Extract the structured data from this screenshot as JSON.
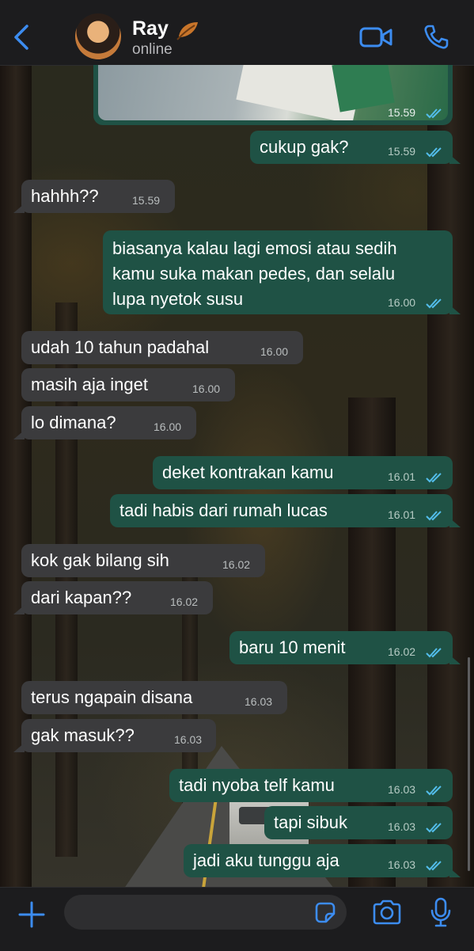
{
  "header": {
    "contact_name": "Ray",
    "status": "online"
  },
  "image_message": {
    "time": "15.59"
  },
  "messages": [
    {
      "dir": "out",
      "text": "cukup gak?",
      "time": "15.59"
    },
    {
      "dir": "in",
      "text": "hahhh??",
      "time": "15.59"
    },
    {
      "dir": "out",
      "lines": [
        "biasanya kalau lagi emosi atau sedih",
        "kamu suka makan pedes, dan selalu",
        "lupa nyetok susu"
      ],
      "time": "16.00"
    },
    {
      "dir": "in",
      "text": "udah 10 tahun padahal",
      "time": "16.00"
    },
    {
      "dir": "in",
      "text": "masih aja inget",
      "time": "16.00"
    },
    {
      "dir": "in",
      "text": "lo dimana?",
      "time": "16.00"
    },
    {
      "dir": "out",
      "text": "deket kontrakan kamu",
      "time": "16.01"
    },
    {
      "dir": "out",
      "text": "tadi habis dari rumah lucas",
      "time": "16.01"
    },
    {
      "dir": "in",
      "text": "kok gak bilang sih",
      "time": "16.02"
    },
    {
      "dir": "in",
      "text": "dari kapan??",
      "time": "16.02"
    },
    {
      "dir": "out",
      "text": "baru 10 menit",
      "time": "16.02"
    },
    {
      "dir": "in",
      "text": "terus ngapain disana",
      "time": "16.03"
    },
    {
      "dir": "in",
      "text": "gak masuk??",
      "time": "16.03"
    },
    {
      "dir": "out",
      "text": "tadi nyoba telf kamu",
      "time": "16.03"
    },
    {
      "dir": "out",
      "text": "tapi sibuk",
      "time": "16.03"
    },
    {
      "dir": "out",
      "text": "jadi aku tunggu aja",
      "time": "16.03"
    }
  ],
  "composer": {
    "placeholder": ""
  },
  "colors": {
    "accent": "#3c8cf0",
    "outgoing_bubble": "#1f5245",
    "incoming_bubble": "#3b3b3d",
    "read_tick": "#53bdeb"
  },
  "icons": [
    "back-icon",
    "leaf-icon",
    "video-call-icon",
    "phone-call-icon",
    "plus-icon",
    "sticker-icon",
    "camera-icon",
    "microphone-icon",
    "double-check-icon"
  ]
}
